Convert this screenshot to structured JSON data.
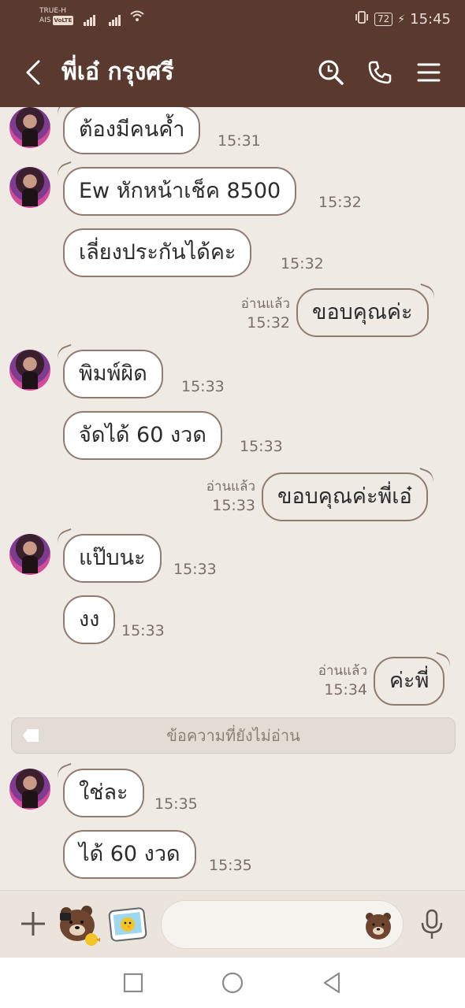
{
  "status_bar": {
    "carrier1": "TRUE-H",
    "carrier2": "AIS",
    "volte": "VoLTE",
    "battery": "72",
    "time": "15:45"
  },
  "header": {
    "title": "พี่เอ๋ กรุงศรี",
    "back_icon": "chevron-left-icon",
    "search_icon": "search-icon",
    "call_icon": "phone-icon",
    "menu_icon": "menu-icon"
  },
  "messages": [
    {
      "dir": "in",
      "text": "ต้องมีคนค้ำ",
      "time": "15:31"
    },
    {
      "dir": "in",
      "text": "Ew หักหน้าเช็ค 8500",
      "time": "15:32"
    },
    {
      "dir": "in",
      "text": "เลี่ยงประกันได้คะ",
      "time": "15:32"
    },
    {
      "dir": "out",
      "text": "ขอบคุณค่ะ",
      "read": "อ่านแล้ว",
      "time": "15:32"
    },
    {
      "dir": "in",
      "text": "พิมพ์ผิด",
      "time": "15:33"
    },
    {
      "dir": "in",
      "text": "จัดได้ 60 งวด",
      "time": "15:33"
    },
    {
      "dir": "out",
      "text": "ขอบคุณค่ะพี่เอ๋",
      "read": "อ่านแล้ว",
      "time": "15:33"
    },
    {
      "dir": "in",
      "text": "แป๊บนะ",
      "time": "15:33"
    },
    {
      "dir": "in",
      "text": "งง",
      "time": "15:33"
    },
    {
      "dir": "out",
      "text": "ค่ะพี่",
      "read": "อ่านแล้ว",
      "time": "15:34"
    },
    {
      "dir": "in",
      "text": "ใช่ละ",
      "time": "15:35"
    },
    {
      "dir": "in",
      "text": "ได้ 60 งวด",
      "time": "15:35"
    }
  ],
  "unread_divider": "ข้อความที่ยังไม่อ่าน",
  "input": {
    "placeholder": "",
    "value": ""
  },
  "colors": {
    "header": "#5a3a2e",
    "background": "#efeae4",
    "bubble_border": "#8f7b6f"
  }
}
